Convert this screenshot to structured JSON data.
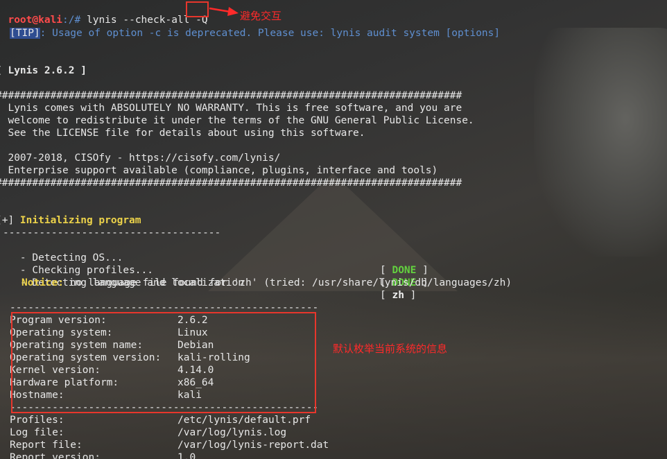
{
  "prompt": {
    "user": "root@kali",
    "path": ":/#",
    "command": " lynis --check-all ",
    "flag": "-Q"
  },
  "annotation_top": "避免交互",
  "tip": {
    "tag": "[TIP]",
    "text": ": Usage of option -c is deprecated. Please use: lynis audit system [options]"
  },
  "banner_title": "[ Lynis 2.6.2 ]",
  "hash_line": "#############################################################################",
  "license": [
    "  Lynis comes with ABSOLUTELY NO WARRANTY. This is free software, and you are",
    "  welcome to redistribute it under the terms of the GNU General Public License.",
    "  See the LICENSE file for details about using this software.",
    "",
    "  2007-2018, CISOfy - https://cisofy.com/lynis/",
    "  Enterprise support available (compliance, plugins, interface and tools)"
  ],
  "section": {
    "marker": "[+] ",
    "title": "Initializing program"
  },
  "section_dashes": "------------------------------------",
  "steps": [
    {
      "label": "  - Detecting OS...",
      "status": "DONE"
    },
    {
      "label": "  - Checking profiles...",
      "status": "DONE"
    },
    {
      "label": "  - Detecting language and localization",
      "status": "zh"
    }
  ],
  "status_open": "[ ",
  "status_close": " ]",
  "notice": {
    "label": "Notice:",
    "text": " no language file found for 'zh' (tried: /usr/share/lynis/db/languages/zh)"
  },
  "separator": "---------------------------------------------------",
  "system_info": [
    {
      "key": "Program version:",
      "value": "2.6.2"
    },
    {
      "key": "Operating system:",
      "value": "Linux"
    },
    {
      "key": "Operating system name:",
      "value": "Debian"
    },
    {
      "key": "Operating system version:",
      "value": "kali-rolling"
    },
    {
      "key": "Kernel version:",
      "value": "4.14.0"
    },
    {
      "key": "Hardware platform:",
      "value": "x86_64"
    },
    {
      "key": "Hostname:",
      "value": "kali"
    }
  ],
  "files": [
    {
      "key": "Profiles:",
      "value": "/etc/lynis/default.prf"
    },
    {
      "key": "Log file:",
      "value": "/var/log/lynis.log"
    },
    {
      "key": "Report file:",
      "value": "/var/log/lynis-report.dat"
    },
    {
      "key": "Report version:",
      "value": "1.0"
    }
  ],
  "annotation_right": "默认枚举当前系统的信息",
  "colors": {
    "accent_red": "#e8362c",
    "prompt_red": "#ff4b4b",
    "tip_blue": "#5f8fd0",
    "done_green": "#63d13f",
    "notice_yellow": "#ecd24a"
  }
}
